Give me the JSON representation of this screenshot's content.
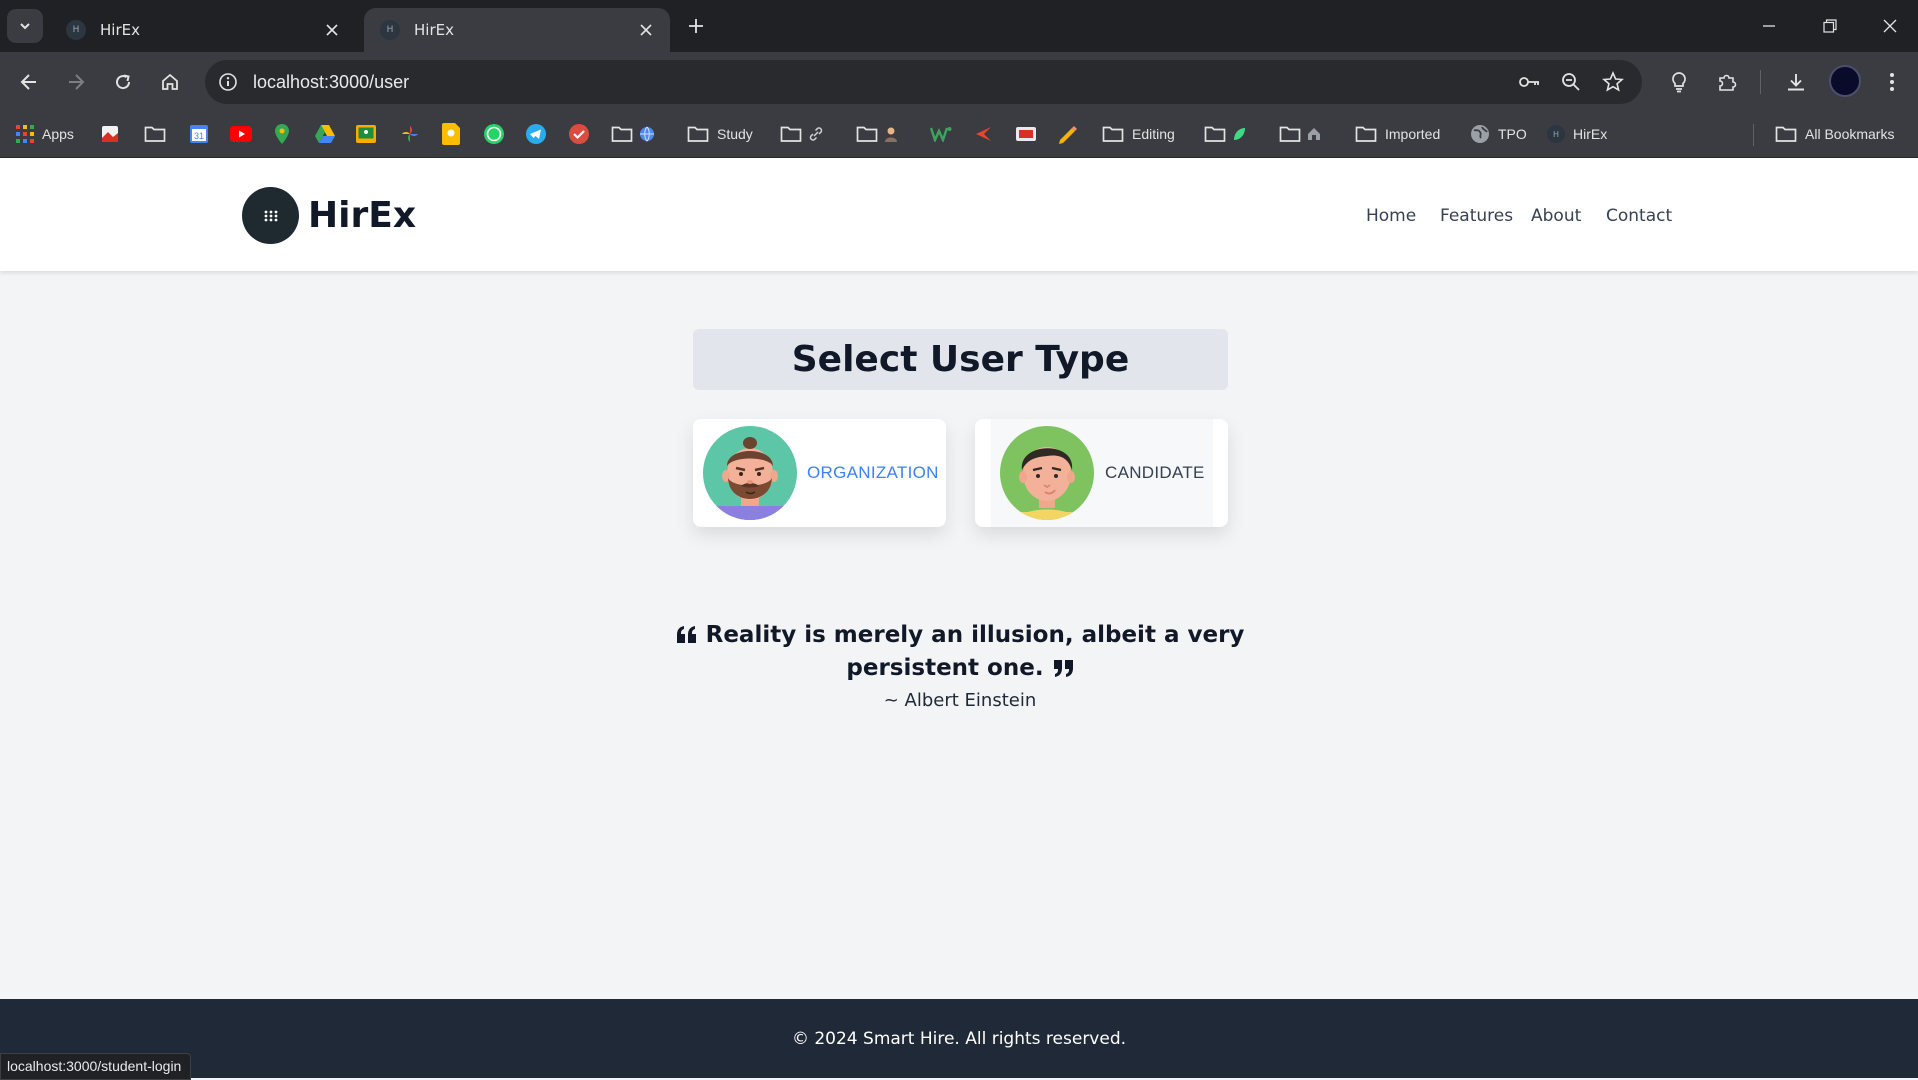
{
  "browser": {
    "tabs": [
      {
        "title": "HirEx",
        "favicon": "H",
        "active": false
      },
      {
        "title": "HirEx",
        "favicon": "H",
        "active": true
      }
    ],
    "address_bar": {
      "url": "localhost:3000/user"
    },
    "bookmarks": {
      "apps": "Apps",
      "study": "Study",
      "editing": "Editing",
      "imported": "Imported",
      "tpo": "TPO",
      "hirex": "HirEx",
      "all_bookmarks": "All Bookmarks"
    },
    "status_url": "localhost:3000/student-login"
  },
  "navbar": {
    "brand": "HirEx",
    "links": [
      "Home",
      "Features",
      "About",
      "Contact"
    ]
  },
  "main": {
    "heading": "Select User Type",
    "options": [
      {
        "label": "ORGANIZATION",
        "icon": "bearded-man-avatar",
        "color": "#3b82f6"
      },
      {
        "label": "CANDIDATE",
        "icon": "young-man-avatar",
        "color": "#374151"
      }
    ],
    "quote": {
      "text": "Reality is merely an illusion, albeit a very persistent one.",
      "author": "~ Albert Einstein"
    }
  },
  "footer": {
    "text": "© 2024 Smart Hire. All rights reserved."
  },
  "colors": {
    "tab_bar": "#1f2125",
    "toolbar": "#3a3c41",
    "page_bg": "#f3f4f6",
    "footer_bg": "#1f2937",
    "logo_bg": "#1f2a30",
    "organization_accent": "#3b82f6"
  }
}
